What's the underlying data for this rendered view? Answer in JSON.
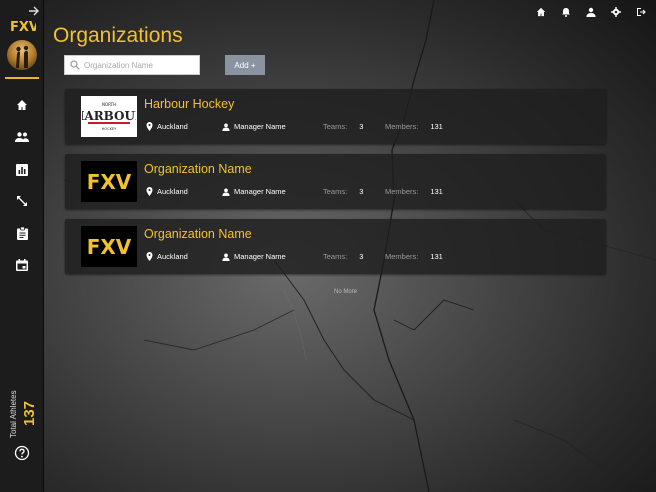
{
  "sidebar": {
    "logo_text": "FXV",
    "items": [
      {
        "icon": "home-icon"
      },
      {
        "icon": "people-icon"
      },
      {
        "icon": "chart-icon"
      },
      {
        "icon": "expand-arrows-icon"
      },
      {
        "icon": "clipboard-icon"
      },
      {
        "icon": "calendar-icon"
      }
    ],
    "total_label": "Total Athletes",
    "total_value": "137"
  },
  "topnav": [
    "home-icon",
    "bell-icon",
    "user-icon",
    "gear-icon",
    "logout-icon"
  ],
  "page": {
    "title": "Organizations",
    "search_placeholder": "Organization Name",
    "add_label": "Add +"
  },
  "organizations": [
    {
      "name": "Harbour Hockey",
      "logo": "harbour-hockey",
      "logo_lines": [
        "NORTH",
        "HARBOUR",
        "HOCKEY"
      ],
      "location": "Auckland",
      "manager": "Manager Name",
      "teams_label": "Teams:",
      "teams": "3",
      "members_label": "Members:",
      "members": "131"
    },
    {
      "name": "Organization Name",
      "logo": "fxv",
      "logo_lines": [
        "FXV"
      ],
      "location": "Auckland",
      "manager": "Manager Name",
      "teams_label": "Teams:",
      "teams": "3",
      "members_label": "Members:",
      "members": "131"
    },
    {
      "name": "Organization Name",
      "logo": "fxv",
      "logo_lines": [
        "FXV"
      ],
      "location": "Auckland",
      "manager": "Manager Name",
      "teams_label": "Teams:",
      "teams": "3",
      "members_label": "Members:",
      "members": "131"
    }
  ],
  "footer_note": "No More",
  "colors": {
    "accent": "#f2c12e",
    "sidebar": "#1c1c1c",
    "card": "#1e1e1e",
    "button": "#8a94a0"
  }
}
